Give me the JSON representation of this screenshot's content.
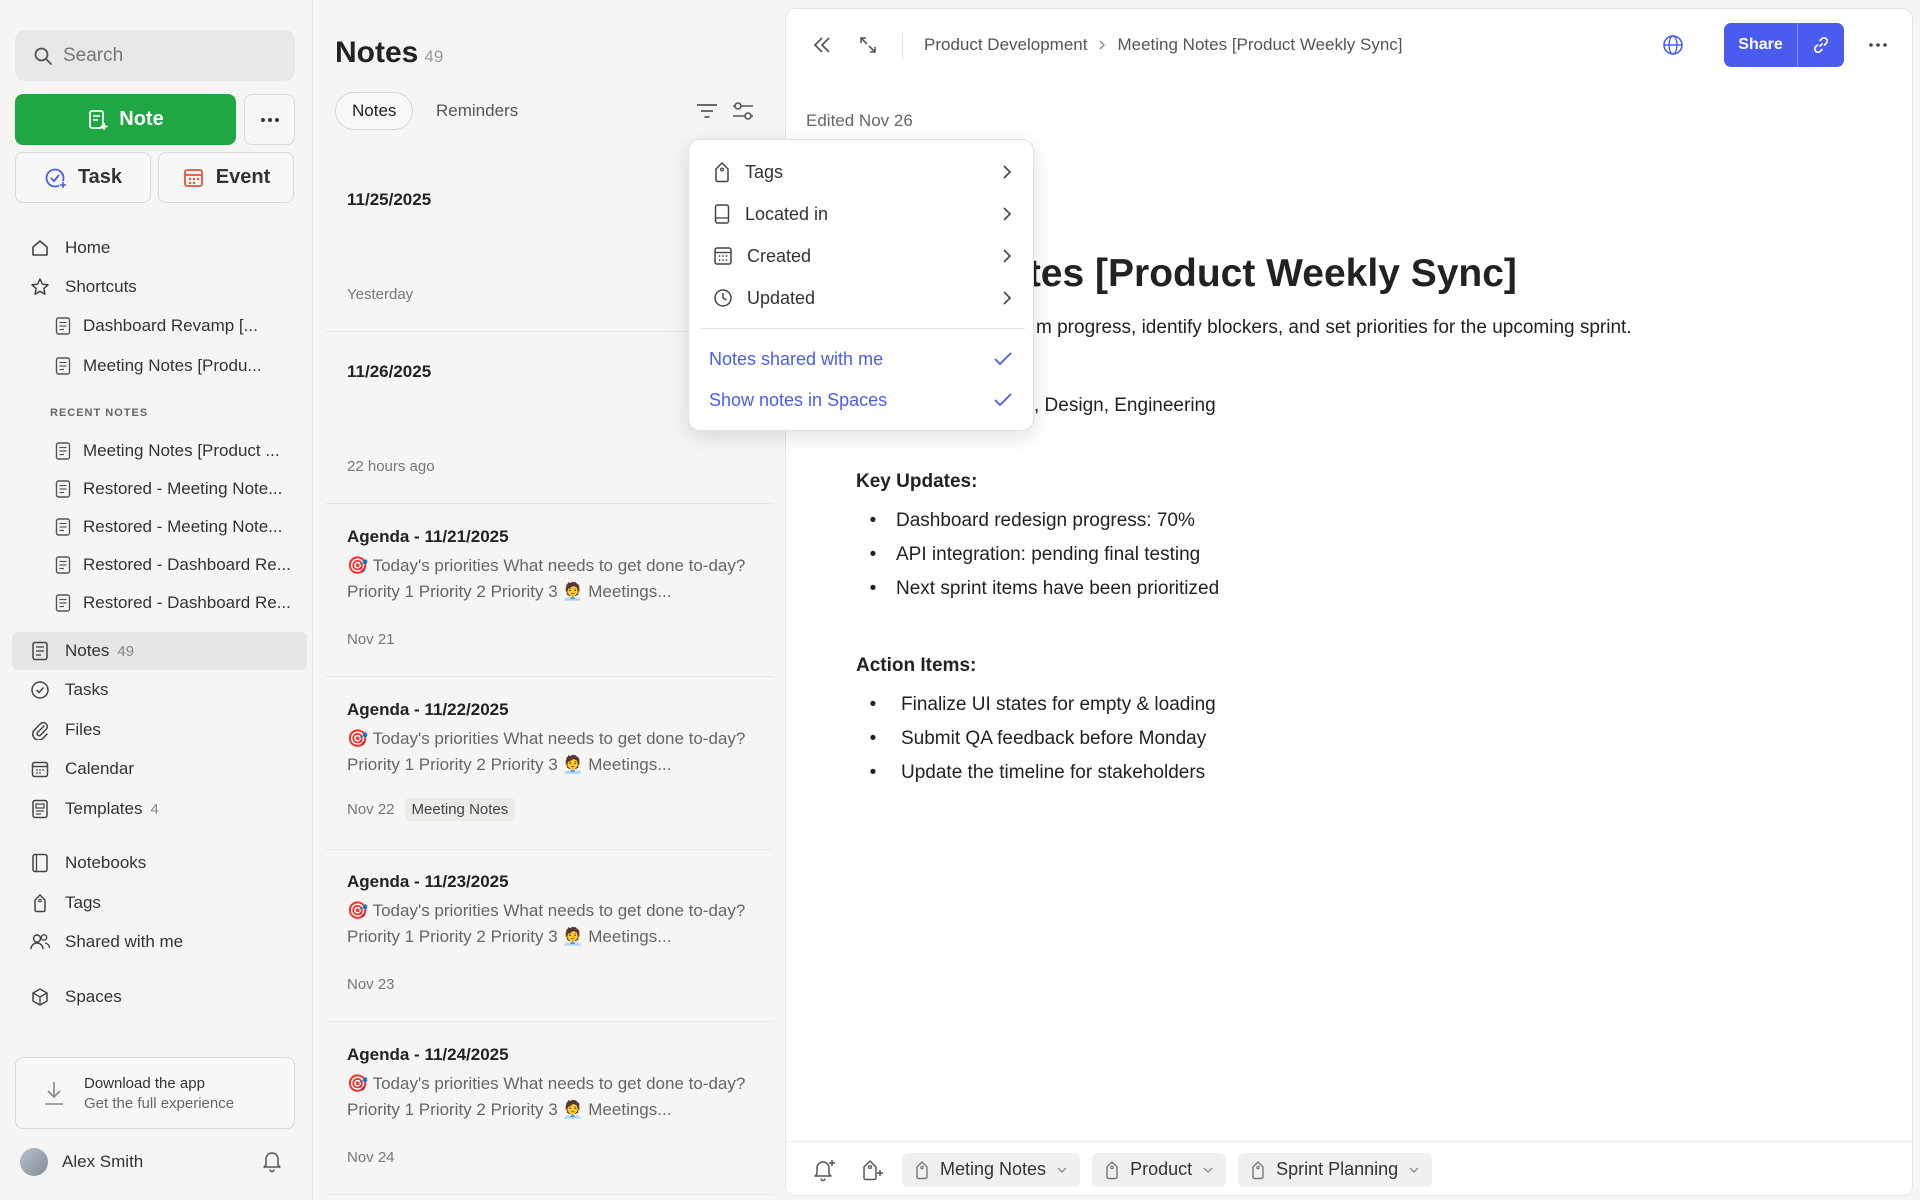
{
  "sidebar": {
    "search_placeholder": "Search",
    "note_button": "Note",
    "task_button": "Task",
    "event_button": "Event",
    "home": "Home",
    "shortcuts": "Shortcuts",
    "shortcut_items": [
      "Dashboard Revamp [...",
      "Meeting Notes [Produ..."
    ],
    "recent_label": "RECENT NOTES",
    "recent_items": [
      "Meeting Notes [Product ...",
      "Restored - Meeting Note...",
      "Restored - Meeting Note...",
      "Restored - Dashboard Re...",
      "Restored - Dashboard Re..."
    ],
    "notes": "Notes",
    "notes_count": "49",
    "tasks": "Tasks",
    "files": "Files",
    "calendar": "Calendar",
    "templates": "Templates",
    "templates_count": "4",
    "notebooks": "Notebooks",
    "tags": "Tags",
    "shared": "Shared with me",
    "spaces": "Spaces",
    "download_title": "Download the app",
    "download_sub": "Get the full experience",
    "user_name": "Alex Smith"
  },
  "list": {
    "title": "Notes",
    "count": "49",
    "tabs": [
      "Notes",
      "Reminders"
    ],
    "cards": [
      {
        "title": "11/25/2025",
        "preview": "",
        "date": "Yesterday",
        "tag": ""
      },
      {
        "title": "11/26/2025",
        "preview": "",
        "date": "22 hours ago",
        "tag": ""
      },
      {
        "title": "Agenda - 11/21/2025",
        "preview": "🎯 Today's priorities What needs to get done to-day? Priority 1 Priority 2 Priority 3 🧑‍💼 Meetings...",
        "date": "Nov 21",
        "tag": ""
      },
      {
        "title": "Agenda - 11/22/2025",
        "preview": "🎯 Today's priorities What needs to get done to-day? Priority 1 Priority 2 Priority 3 🧑‍💼 Meetings...",
        "date": "Nov 22",
        "tag": "Meeting Notes"
      },
      {
        "title": "Agenda - 11/23/2025",
        "preview": "🎯 Today's priorities What needs to get done to-day? Priority 1 Priority 2 Priority 3 🧑‍💼 Meetings...",
        "date": "Nov 23",
        "tag": ""
      },
      {
        "title": "Agenda - 11/24/2025",
        "preview": "🎯 Today's priorities What needs to get done to-day? Priority 1 Priority 2 Priority 3 🧑‍💼 Meetings...",
        "date": "Nov 24",
        "tag": ""
      }
    ]
  },
  "editor": {
    "breadcrumb": [
      "Product Development",
      "Meeting Notes [Product Weekly Sync]"
    ],
    "share_label": "Share",
    "edited": "Edited Nov 26",
    "title_visible": "otes [Product Weekly Sync]",
    "goal_visible": "m progress, identify blockers, and set priorities for the upcoming sprint.",
    "attendees_visible": ", Design, Engineering",
    "key_updates_heading": "Key Updates:",
    "key_updates": [
      "Dashboard redesign progress: 70%",
      "API integration: pending final testing",
      "Next sprint items have been prioritized"
    ],
    "action_items_heading": "Action Items:",
    "action_items": [
      "Finalize UI states for empty & loading",
      "Submit QA feedback before Monday",
      "Update the timeline for stakeholders"
    ],
    "tags": [
      "Meting Notes",
      "Product",
      "Sprint Planning"
    ]
  },
  "filter_menu": {
    "items": [
      "Tags",
      "Located in",
      "Created",
      "Updated"
    ],
    "options": [
      "Notes shared with me",
      "Show notes in Spaces"
    ]
  },
  "colors": {
    "accent": "#4a5cf0",
    "note_button": "#1fa744"
  }
}
